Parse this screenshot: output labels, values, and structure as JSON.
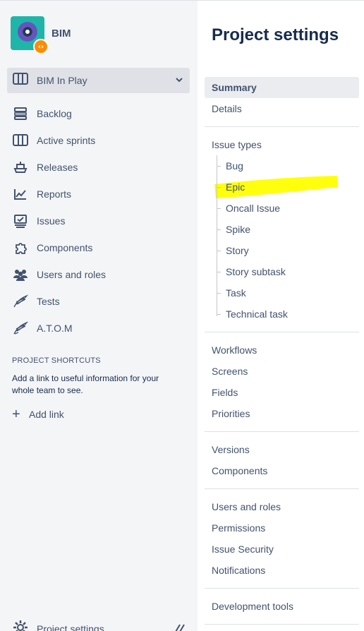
{
  "project": {
    "name": "BIM",
    "badge_glyph": "‹›"
  },
  "board_selector": {
    "label": "BIM In Play"
  },
  "nav": {
    "items": [
      {
        "label": "Backlog",
        "icon": "backlog-icon"
      },
      {
        "label": "Active sprints",
        "icon": "board-icon"
      },
      {
        "label": "Releases",
        "icon": "ship-icon"
      },
      {
        "label": "Reports",
        "icon": "chart-icon"
      },
      {
        "label": "Issues",
        "icon": "issues-icon"
      },
      {
        "label": "Components",
        "icon": "puzzle-icon"
      },
      {
        "label": "Users and roles",
        "icon": "people-icon"
      },
      {
        "label": "Tests",
        "icon": "wing-icon"
      },
      {
        "label": "A.T.O.M",
        "icon": "wing-icon"
      }
    ]
  },
  "shortcuts": {
    "title": "PROJECT SHORTCUTS",
    "description": "Add a link to useful information for your whole team to see.",
    "add_link_label": "Add link"
  },
  "bottom": {
    "settings_label": "Project settings"
  },
  "settings": {
    "title": "Project settings",
    "summary": "Summary",
    "details": "Details",
    "issue_types_label": "Issue types",
    "issue_types": [
      "Bug",
      "Epic",
      "Oncall Issue",
      "Spike",
      "Story",
      "Story subtask",
      "Task",
      "Technical task"
    ],
    "workflows": "Workflows",
    "screens": "Screens",
    "fields": "Fields",
    "priorities": "Priorities",
    "versions": "Versions",
    "components": "Components",
    "users_and_roles": "Users and roles",
    "permissions": "Permissions",
    "issue_security": "Issue Security",
    "notifications": "Notifications",
    "development_tools": "Development tools"
  },
  "colors": {
    "highlight": "#ffff00",
    "sidebar_bg": "#f4f5f7",
    "selected_bg": "#dfe1e6"
  }
}
